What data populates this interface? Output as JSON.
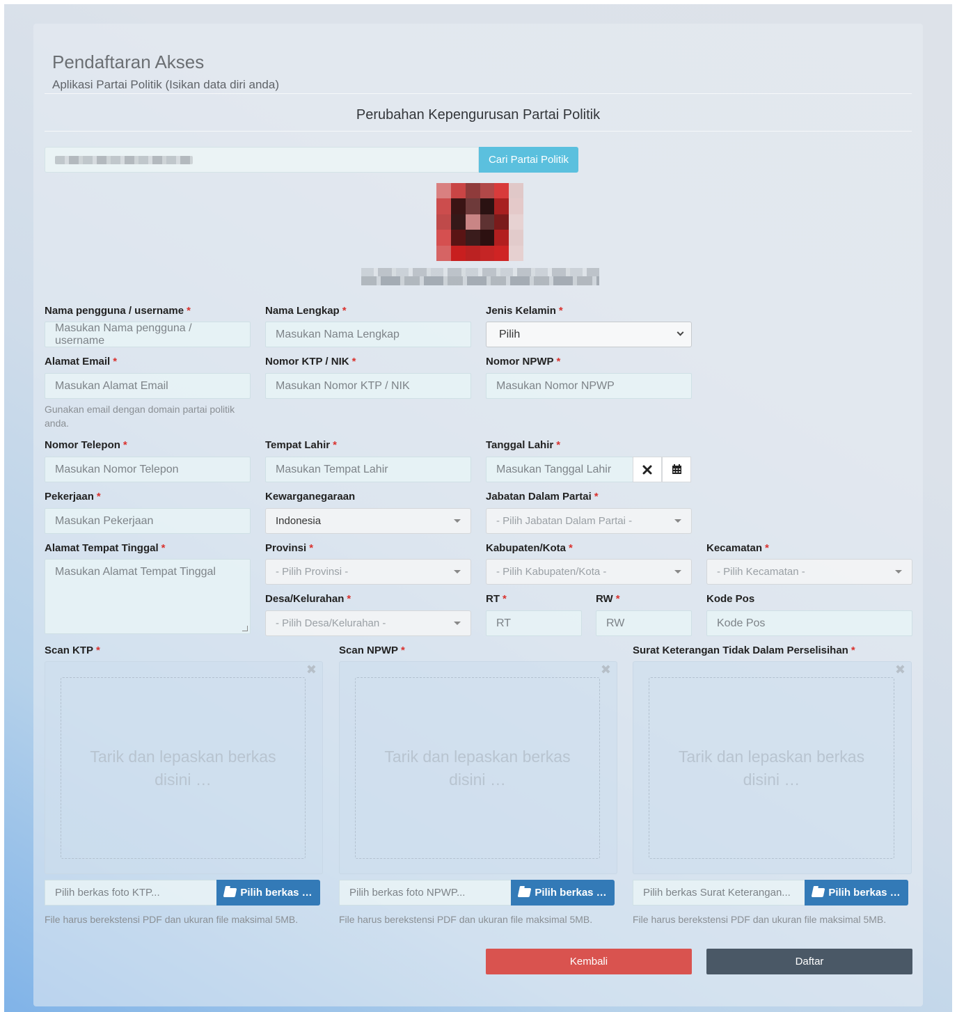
{
  "header": {
    "title": "Pendaftaran Akses",
    "subtitle": "Aplikasi Partai Politik (Isikan data diri anda)",
    "section_title": "Perubahan Kepengurusan Partai Politik"
  },
  "search": {
    "button_label": "Cari Partai Politik"
  },
  "form": {
    "username": {
      "label": "Nama pengguna / username",
      "required": "*",
      "placeholder": "Masukan Nama pengguna / username"
    },
    "fullname": {
      "label": "Nama Lengkap",
      "required": "*",
      "placeholder": "Masukan Nama Lengkap"
    },
    "gender": {
      "label": "Jenis Kelamin",
      "required": "*",
      "value": "Pilih"
    },
    "email": {
      "label": "Alamat Email",
      "required": "*",
      "placeholder": "Masukan Alamat Email",
      "help": "Gunakan email dengan domain partai politik anda."
    },
    "ktp": {
      "label": "Nomor KTP / NIK",
      "required": "*",
      "placeholder": "Masukan Nomor KTP / NIK"
    },
    "npwp": {
      "label": "Nomor NPWP",
      "required": "*",
      "placeholder": "Masukan Nomor NPWP"
    },
    "phone": {
      "label": "Nomor Telepon",
      "required": "*",
      "placeholder": "Masukan Nomor Telepon"
    },
    "birthplace": {
      "label": "Tempat Lahir",
      "required": "*",
      "placeholder": "Masukan Tempat Lahir"
    },
    "birthdate": {
      "label": "Tanggal Lahir",
      "required": "*",
      "placeholder": "Masukan Tanggal Lahir"
    },
    "job": {
      "label": "Pekerjaan",
      "required": "*",
      "placeholder": "Masukan Pekerjaan"
    },
    "citizenship": {
      "label": "Kewarganegaraan",
      "value": "Indonesia"
    },
    "position": {
      "label": "Jabatan Dalam Partai",
      "required": "*",
      "value": "- Pilih Jabatan Dalam Partai -"
    },
    "address": {
      "label": "Alamat Tempat Tinggal",
      "required": "*",
      "placeholder": "Masukan Alamat Tempat Tinggal"
    },
    "province": {
      "label": "Provinsi",
      "required": "*",
      "value": "- Pilih Provinsi -"
    },
    "regency": {
      "label": "Kabupaten/Kota",
      "required": "*",
      "value": "- Pilih Kabupaten/Kota -"
    },
    "district": {
      "label": "Kecamatan",
      "required": "*",
      "value": "- Pilih Kecamatan -"
    },
    "village": {
      "label": "Desa/Kelurahan",
      "required": "*",
      "value": "- Pilih Desa/Kelurahan -"
    },
    "rt": {
      "label": "RT",
      "required": "*",
      "placeholder": "RT"
    },
    "rw": {
      "label": "RW",
      "required": "*",
      "placeholder": "RW"
    },
    "postal": {
      "label": "Kode Pos",
      "placeholder": "Kode Pos"
    }
  },
  "uploads": [
    {
      "label": "Scan KTP",
      "required": "*",
      "drop_text": "Tarik dan lepaskan berkas disini …",
      "file_placeholder": "Pilih berkas foto KTP...",
      "button": "Pilih berkas …",
      "note": "File harus berekstensi PDF dan ukuran file maksimal 5MB."
    },
    {
      "label": "Scan NPWP",
      "required": "*",
      "drop_text": "Tarik dan lepaskan berkas disini …",
      "file_placeholder": "Pilih berkas foto NPWP...",
      "button": "Pilih berkas …",
      "note": "File harus berekstensi PDF dan ukuran file maksimal 5MB."
    },
    {
      "label": "Surat Keterangan Tidak Dalam Perselisihan",
      "required": "*",
      "drop_text": "Tarik dan lepaskan berkas disini …",
      "file_placeholder": "Pilih berkas Surat Keterangan...",
      "button": "Pilih berkas …",
      "note": "File harus berekstensi PDF dan ukuran file maksimal 5MB."
    }
  ],
  "actions": {
    "back": "Kembali",
    "submit": "Daftar"
  },
  "icons": {
    "clear": "times-icon",
    "calendar": "calendar-icon",
    "folder": "folder-open-icon",
    "close": "close-icon"
  },
  "colors": {
    "info": "#5bc0de",
    "primary": "#337ab7",
    "danger": "#d9534f",
    "dark": "#4a5866",
    "required": "#d9322e"
  }
}
